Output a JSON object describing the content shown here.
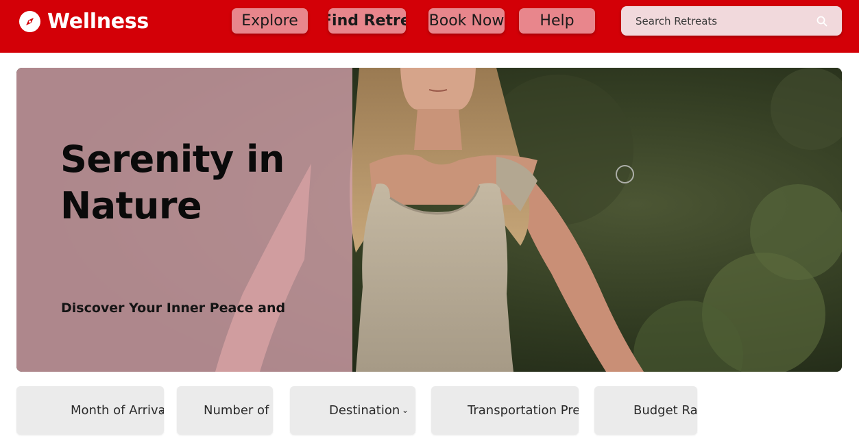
{
  "header": {
    "brand": "Wellness",
    "nav": {
      "explore": "Explore",
      "find_retreat": "Find Retreat",
      "book_now": "Book Now",
      "help": "Help"
    },
    "search": {
      "placeholder": "Search Retreats"
    }
  },
  "hero": {
    "title": "Serenity in Nature",
    "subtitle": "Discover Your Inner Peace and"
  },
  "filters": {
    "month": "Month of Arrival",
    "guests": "Number of Guests",
    "destination": "Destination",
    "transportation": "Transportation Preference",
    "budget": "Budget Range"
  },
  "colors": {
    "brand_red": "#d30007",
    "nav_button": "#e8868c",
    "search_bg": "#f1d9dc",
    "hero_panel": "#d2a0aa",
    "filter_bg": "#ebebeb"
  },
  "icons": [
    "compass-icon",
    "search-icon",
    "chevron-down-icon"
  ]
}
